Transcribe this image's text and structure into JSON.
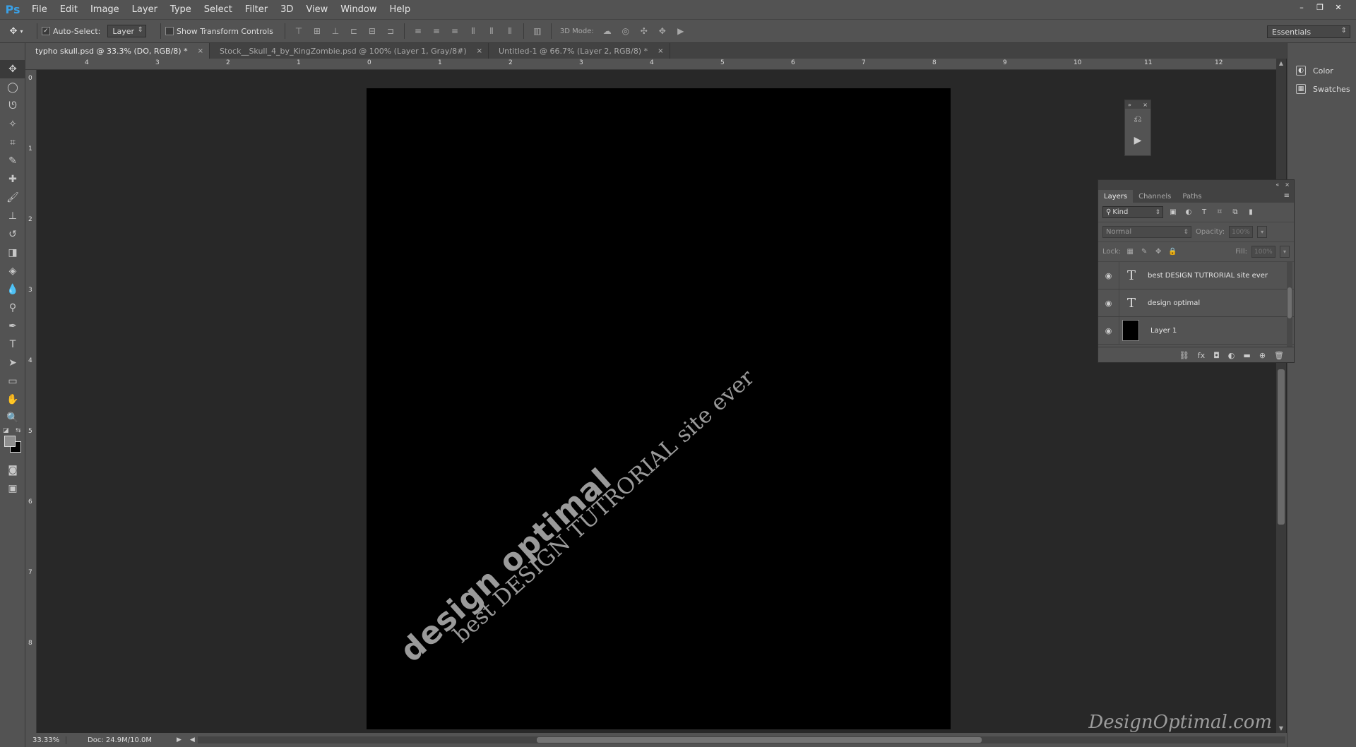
{
  "app": {
    "logo": "Ps"
  },
  "menu": [
    "File",
    "Edit",
    "Image",
    "Layer",
    "Type",
    "Select",
    "Filter",
    "3D",
    "View",
    "Window",
    "Help"
  ],
  "window_controls": [
    "–",
    "❐",
    "✕"
  ],
  "options": {
    "auto_select_label": "Auto-Select:",
    "auto_select_value": "Layer",
    "show_transform_label": "Show Transform Controls",
    "mode3d_label": "3D Mode:",
    "workspace": "Essentials"
  },
  "tabs": [
    {
      "label": "typho skull.psd @ 33.3% (DO, RGB/8) *",
      "close": "×"
    },
    {
      "label": "Stock__Skull_4_by_KingZombie.psd @ 100% (Layer 1, Gray/8#)",
      "close": "×"
    },
    {
      "label": "Untitled-1 @ 66.7% (Layer 2, RGB/8) *",
      "close": "×"
    }
  ],
  "ruler_h": [
    "4",
    "3",
    "2",
    "1",
    "0",
    "1",
    "2",
    "3",
    "4",
    "5",
    "6",
    "7",
    "8",
    "9",
    "10",
    "11",
    "12"
  ],
  "ruler_v": [
    "0",
    "1",
    "2",
    "3",
    "4",
    "5",
    "6",
    "7",
    "8"
  ],
  "canvas": {
    "text_1": "design optimal",
    "text_2": "best DESIGN TUTRORIAL site ever",
    "watermark": "DesignOptimal.com"
  },
  "status": {
    "zoom": "33.33%",
    "doc": "Doc: 24.9M/10.0M"
  },
  "dock": [
    {
      "label": "Color",
      "icon": "color-palette-icon"
    },
    {
      "label": "Swatches",
      "icon": "swatches-grid-icon"
    }
  ],
  "layers_panel": {
    "tabs": [
      "Layers",
      "Channels",
      "Paths"
    ],
    "kind": "Kind",
    "blend": "Normal",
    "opacity_label": "Opacity:",
    "opacity_value": "100%",
    "lock_label": "Lock:",
    "fill_label": "Fill:",
    "fill_value": "100%",
    "layers": [
      {
        "name": "best DESIGN TUTRORIAL site ever",
        "type": "text"
      },
      {
        "name": "design optimal",
        "type": "text"
      },
      {
        "name": "Layer 1",
        "type": "pixel"
      }
    ]
  }
}
